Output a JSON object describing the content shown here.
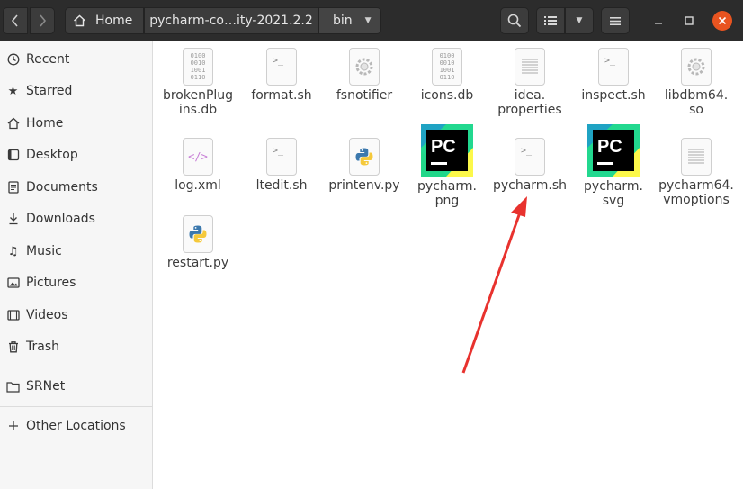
{
  "header": {
    "breadcrumbs": [
      "Home",
      "pycharm-co…ity-2021.2.2",
      "bin"
    ]
  },
  "sidebar": {
    "items": [
      {
        "label": "Recent",
        "icon": "clock-icon"
      },
      {
        "label": "Starred",
        "icon": "star-icon"
      },
      {
        "label": "Home",
        "icon": "home-icon"
      },
      {
        "label": "Desktop",
        "icon": "desktop-icon"
      },
      {
        "label": "Documents",
        "icon": "documents-icon"
      },
      {
        "label": "Downloads",
        "icon": "download-icon"
      },
      {
        "label": "Music",
        "icon": "music-icon"
      },
      {
        "label": "Pictures",
        "icon": "pictures-icon"
      },
      {
        "label": "Videos",
        "icon": "videos-icon"
      },
      {
        "label": "Trash",
        "icon": "trash-icon"
      }
    ],
    "network": {
      "label": "SRNet",
      "icon": "folder-icon"
    },
    "other": {
      "label": "Other Locations",
      "icon": "plus-icon"
    }
  },
  "files": [
    {
      "name_l1": "brokenPlug",
      "name_l2": "ins.db",
      "type": "binary"
    },
    {
      "name_l1": "format.sh",
      "name_l2": "",
      "type": "script"
    },
    {
      "name_l1": "fsnotifier",
      "name_l2": "",
      "type": "executable"
    },
    {
      "name_l1": "icons.db",
      "name_l2": "",
      "type": "binary"
    },
    {
      "name_l1": "idea.",
      "name_l2": "properties",
      "type": "text"
    },
    {
      "name_l1": "inspect.sh",
      "name_l2": "",
      "type": "script"
    },
    {
      "name_l1": "libdbm64.",
      "name_l2": "so",
      "type": "executable"
    },
    {
      "name_l1": "log.xml",
      "name_l2": "",
      "type": "xml"
    },
    {
      "name_l1": "ltedit.sh",
      "name_l2": "",
      "type": "script"
    },
    {
      "name_l1": "printenv.py",
      "name_l2": "",
      "type": "python"
    },
    {
      "name_l1": "pycharm.",
      "name_l2": "png",
      "type": "pycharm-image"
    },
    {
      "name_l1": "pycharm.sh",
      "name_l2": "",
      "type": "script"
    },
    {
      "name_l1": "pycharm.",
      "name_l2": "svg",
      "type": "pycharm-image"
    },
    {
      "name_l1": "pycharm64.",
      "name_l2": "vmoptions",
      "type": "text"
    },
    {
      "name_l1": "restart.py",
      "name_l2": "",
      "type": "python"
    }
  ],
  "icon_glyphs": {
    "binary": "0100\n0010\n1001\n0110",
    "script": ">_",
    "xml": "</>",
    "pycharm": "PC"
  },
  "colors": {
    "headerbar": "#2c2c2c",
    "close_button": "#e95420",
    "annotation_arrow": "#e8322e"
  }
}
